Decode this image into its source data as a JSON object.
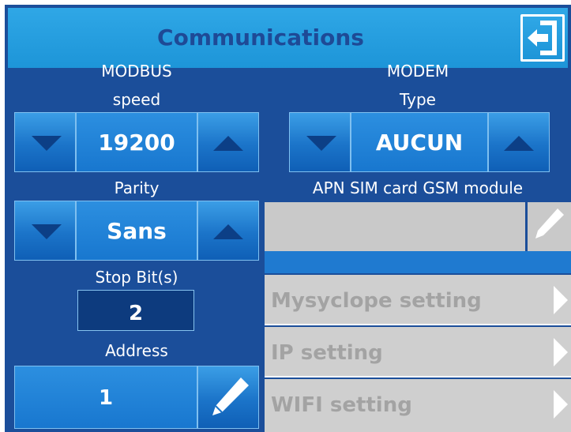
{
  "header": {
    "title": "Communications",
    "exit_icon": "exit-icon"
  },
  "modbus": {
    "section_label": "MODBUS",
    "speed": {
      "label": "speed",
      "value": "19200"
    },
    "parity": {
      "label": "Parity",
      "value": "Sans"
    },
    "stop_bits": {
      "label": "Stop Bit(s)",
      "value": "2"
    },
    "address": {
      "label": "Address",
      "value": "1"
    }
  },
  "modem": {
    "section_label": "MODEM",
    "type": {
      "label": "Type",
      "value": "AUCUN"
    },
    "apn": {
      "label": "APN SIM card GSM module",
      "value": ""
    }
  },
  "menu": [
    {
      "label": "Mysyclope setting"
    },
    {
      "label": "IP setting"
    },
    {
      "label": "WIFI setting"
    }
  ],
  "colors": {
    "background": "#1b4e9a",
    "header": "#2fa7e6",
    "title_text": "#1e4a96",
    "button": "#1b74c9",
    "disabled": "#cfcfcf",
    "disabled_text": "#a3a3a3"
  }
}
